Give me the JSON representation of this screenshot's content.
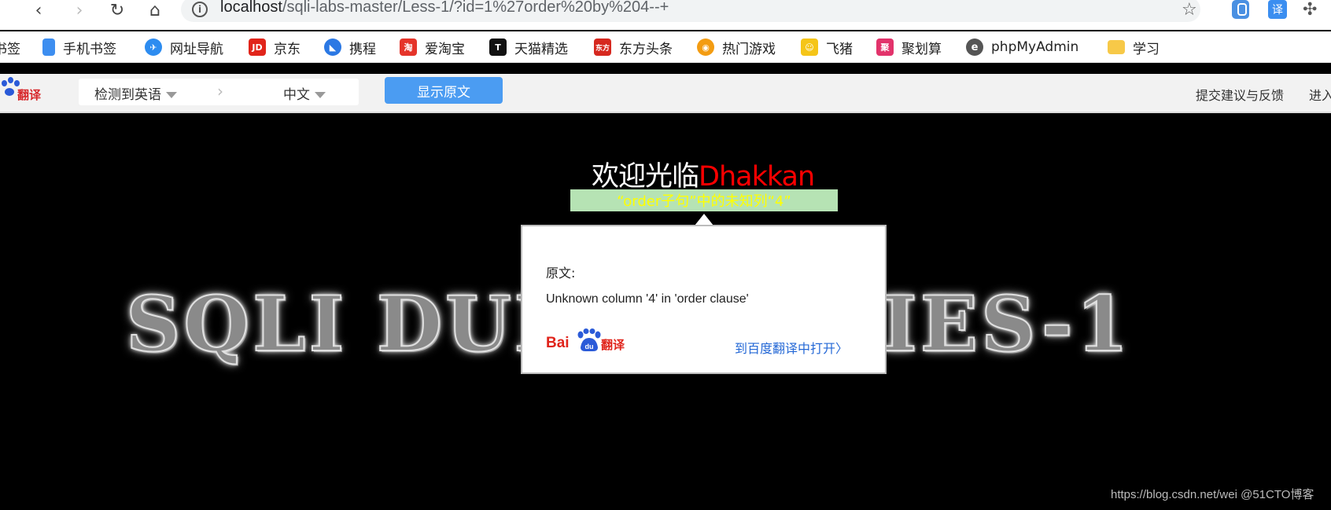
{
  "browser": {
    "url_host": "localhost",
    "url_path": "/sqli-labs-master/Less-1/?id=1%27order%20by%204--+",
    "ext_translate_label": "译"
  },
  "bookmarks": [
    {
      "label": "书签",
      "icon": "bookmark-icon"
    },
    {
      "label": "手机书签",
      "icon": "phone-icon",
      "color": "#3d8ef0"
    },
    {
      "label": "网址导航",
      "icon": "compass-icon",
      "color": "#2d8cf0"
    },
    {
      "label": "京东",
      "icon": "jd-icon",
      "color": "#e1251b",
      "icon_text": "JD"
    },
    {
      "label": "携程",
      "icon": "ctrip-icon",
      "color": "#2b78e4"
    },
    {
      "label": "爱淘宝",
      "icon": "taobao-icon",
      "color": "#e5342a",
      "icon_text": "淘"
    },
    {
      "label": "天猫精选",
      "icon": "tmall-icon",
      "color": "#111",
      "icon_text": "T"
    },
    {
      "label": "东方头条",
      "icon": "dftt-icon",
      "color": "#d6281f",
      "icon_text": "东方"
    },
    {
      "label": "热门游戏",
      "icon": "game-icon",
      "color": "#f39c12"
    },
    {
      "label": "飞猪",
      "icon": "fliggy-icon",
      "color": "#f5c518"
    },
    {
      "label": "聚划算",
      "icon": "juhuasuan-icon",
      "color": "#e2336b",
      "icon_text": "聚"
    },
    {
      "label": "phpMyAdmin",
      "icon": "edge-icon",
      "color": "#555",
      "icon_text": "e"
    },
    {
      "label": "学习",
      "icon": "folder-icon",
      "color": "#f7c948"
    }
  ],
  "translate_bar": {
    "logo_text": "翻译",
    "source_lang": "检测到英语",
    "arrow": "›",
    "target_lang": "中文",
    "show_original": "显示原文",
    "feedback": "提交建议与反馈",
    "advanced": "进入"
  },
  "page": {
    "welcome_prefix": "欢迎光临",
    "welcome_name": "Dhakkan",
    "error_translated": "“order子句”中的未知列“4”",
    "banner": "SQLI DUMB SERIES-1"
  },
  "popup": {
    "label": "原文:",
    "original": "Unknown column '4' in 'order clause'",
    "logo_bai": "Bai",
    "logo_fanyi": "翻译",
    "open_link": "到百度翻译中打开〉"
  },
  "watermark": "https://blog.csdn.net/wei @51CTO博客",
  "colors": {
    "accent_blue": "#4b9cf2",
    "error_red": "#ff0000",
    "error_yellow": "#ffff00",
    "error_bg": "#b6e3b4"
  }
}
